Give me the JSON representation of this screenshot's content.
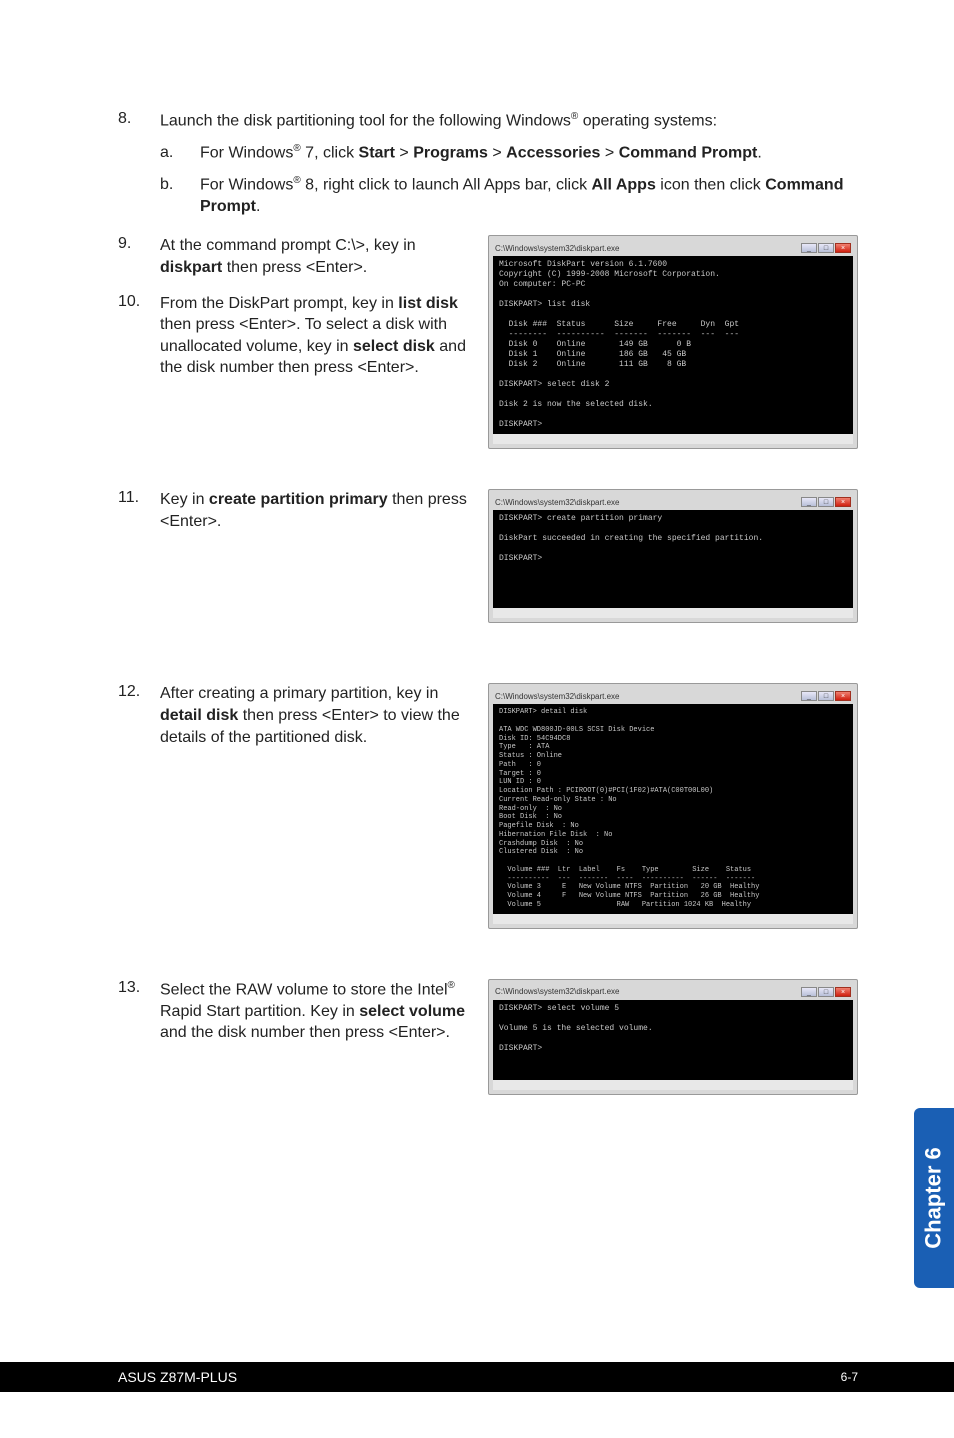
{
  "steps": {
    "s8": {
      "num": "8.",
      "intro": "Launch the disk partitioning tool for the following Windows",
      "intro2": " operating systems:",
      "a_letter": "a.",
      "a_1": "For Windows",
      "a_2": " 7, click ",
      "a_start": "Start",
      "a_gt1": " > ",
      "a_prog": "Programs",
      "a_gt2": " > ",
      "a_acc": "Accessories",
      "a_gt3": " > ",
      "a_cmd": "Command Prompt",
      "a_end": ".",
      "b_letter": "b.",
      "b_1": "For Windows",
      "b_2": " 8, right click to launch All Apps bar, click ",
      "b_allapps": "All Apps",
      "b_3": " icon then click ",
      "b_cmd": "Command Prompt",
      "b_end": "."
    },
    "s9": {
      "num": "9.",
      "t1": "At the command prompt C:\\>, key in ",
      "bold": "diskpart",
      "t2": " then press <Enter>."
    },
    "s10": {
      "num": "10.",
      "t1": "From the DiskPart prompt, key in ",
      "b1": "list disk",
      "t2": " then press <Enter>. To select a disk with unallocated volume, key in ",
      "b2": "select disk",
      "t3": " and the disk number then press <Enter>."
    },
    "s11": {
      "num": "11.",
      "t1": "Key in ",
      "b1": "create partition primary",
      "t2": " then press <Enter>."
    },
    "s12": {
      "num": "12.",
      "t1": "After creating a primary partition, key in ",
      "b1": "detail disk",
      "t2": " then press <Enter> to view the details of the partitioned disk."
    },
    "s13": {
      "num": "13.",
      "t1": "Select the RAW volume to store the Intel",
      "t2": " Rapid Start partition. Key in ",
      "b1": "select volume",
      "t3": " and the disk number then press <Enter>."
    }
  },
  "cmd": {
    "title": "C:\\Windows\\system32\\diskpart.exe",
    "body1": "Microsoft DiskPart version 6.1.7600\nCopyright (C) 1999-2008 Microsoft Corporation.\nOn computer: PC-PC\n\nDISKPART> list disk\n\n  Disk ###  Status      Size     Free     Dyn  Gpt\n  --------  ----------  -------  -------  ---  ---\n  Disk 0    Online       149 GB      0 B\n  Disk 1    Online       186 GB   45 GB\n  Disk 2    Online       111 GB    8 GB\n\nDISKPART> select disk 2\n\nDisk 2 is now the selected disk.\n\nDISKPART>",
    "body2": "DISKPART> create partition primary\n\nDiskPart succeeded in creating the specified partition.\n\nDISKPART>\n\n\n\n\n",
    "body3": "DISKPART> detail disk\n\nATA WDC WD800JD-00LS SCSI Disk Device\nDisk ID: 54C94DC8\nType   : ATA\nStatus : Online\nPath   : 0\nTarget : 0\nLUN ID : 0\nLocation Path : PCIROOT(0)#PCI(1F02)#ATA(C00T00L00)\nCurrent Read-only State : No\nRead-only  : No\nBoot Disk  : No\nPagefile Disk  : No\nHibernation File Disk  : No\nCrashdump Disk  : No\nClustered Disk  : No\n\n  Volume ###  Ltr  Label    Fs    Type        Size    Status\n  ----------  ---  -------  ----  ----------  ------  -------\n  Volume 3     E   New Volume NTFS  Partition   20 GB  Healthy\n  Volume 4     F   New Volume NTFS  Partition   26 GB  Healthy\n  Volume 5                  RAW   Partition 1024 KB  Healthy",
    "body4": "DISKPART> select volume 5\n\nVolume 5 is the selected volume.\n\nDISKPART>\n"
  },
  "chapter": "Chapter 6",
  "footer_left": "ASUS Z87M-PLUS",
  "footer_right": "6-7"
}
